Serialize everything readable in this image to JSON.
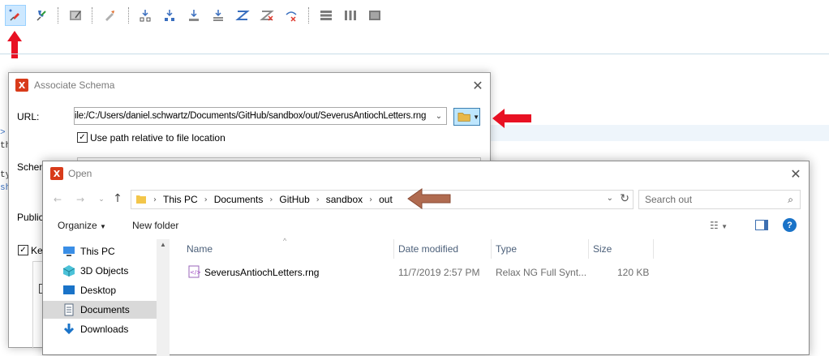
{
  "colors": {
    "accent_red": "#e81123",
    "brown_arrow": "#b06b50",
    "selection_blue": "#cde8ff",
    "app_red": "#d83b1a"
  },
  "toolbar": {
    "buttons": [
      {
        "icon": "associate-schema-icon"
      },
      {
        "icon": "pin-icon"
      },
      {
        "icon": "edit-doc-icon"
      },
      {
        "icon": "pen-icon"
      },
      {
        "icon": "download-tree-icon"
      },
      {
        "icon": "download-tree-blue-icon"
      },
      {
        "icon": "download-icon"
      },
      {
        "icon": "download-stack-icon"
      },
      {
        "icon": "zigzag-icon"
      },
      {
        "icon": "zigzag-cross-icon"
      },
      {
        "icon": "remove-arrow-icon"
      },
      {
        "icon": "rows-icon"
      },
      {
        "icon": "columns-icon"
      },
      {
        "icon": "box-icon"
      }
    ]
  },
  "editor": {
    "fragments": [
      ">",
      "th",
      "ty",
      "sh"
    ]
  },
  "assoc_dialog": {
    "title": "Associate Schema",
    "url_label": "URL:",
    "url_value": "ile:/C:/Users/daniel.schwartz/Documents/GitHub/sandbox/out/SeverusAntiochLetters.rng",
    "use_relative_label": "Use path relative to file location",
    "use_relative_checked": true,
    "schema_label": "Schem",
    "public_label": "Public",
    "keep_label": "Kee"
  },
  "open_dialog": {
    "title": "Open",
    "breadcrumb": [
      "This PC",
      "Documents",
      "GitHub",
      "sandbox",
      "out"
    ],
    "search_placeholder": "Search out",
    "organize_label": "Organize",
    "new_folder_label": "New folder",
    "columns": [
      "Name",
      "Date modified",
      "Type",
      "Size"
    ],
    "nav_tree": [
      {
        "label": "This PC",
        "icon": "computer-icon"
      },
      {
        "label": "3D Objects",
        "icon": "cube-icon"
      },
      {
        "label": "Desktop",
        "icon": "desktop-icon"
      },
      {
        "label": "Documents",
        "icon": "documents-icon",
        "selected": true
      },
      {
        "label": "Downloads",
        "icon": "downloads-icon"
      }
    ],
    "files": [
      {
        "name": "SeverusAntiochLetters.rng",
        "date": "11/7/2019 2:57 PM",
        "type": "Relax NG Full Synt...",
        "size": "120 KB"
      }
    ]
  }
}
